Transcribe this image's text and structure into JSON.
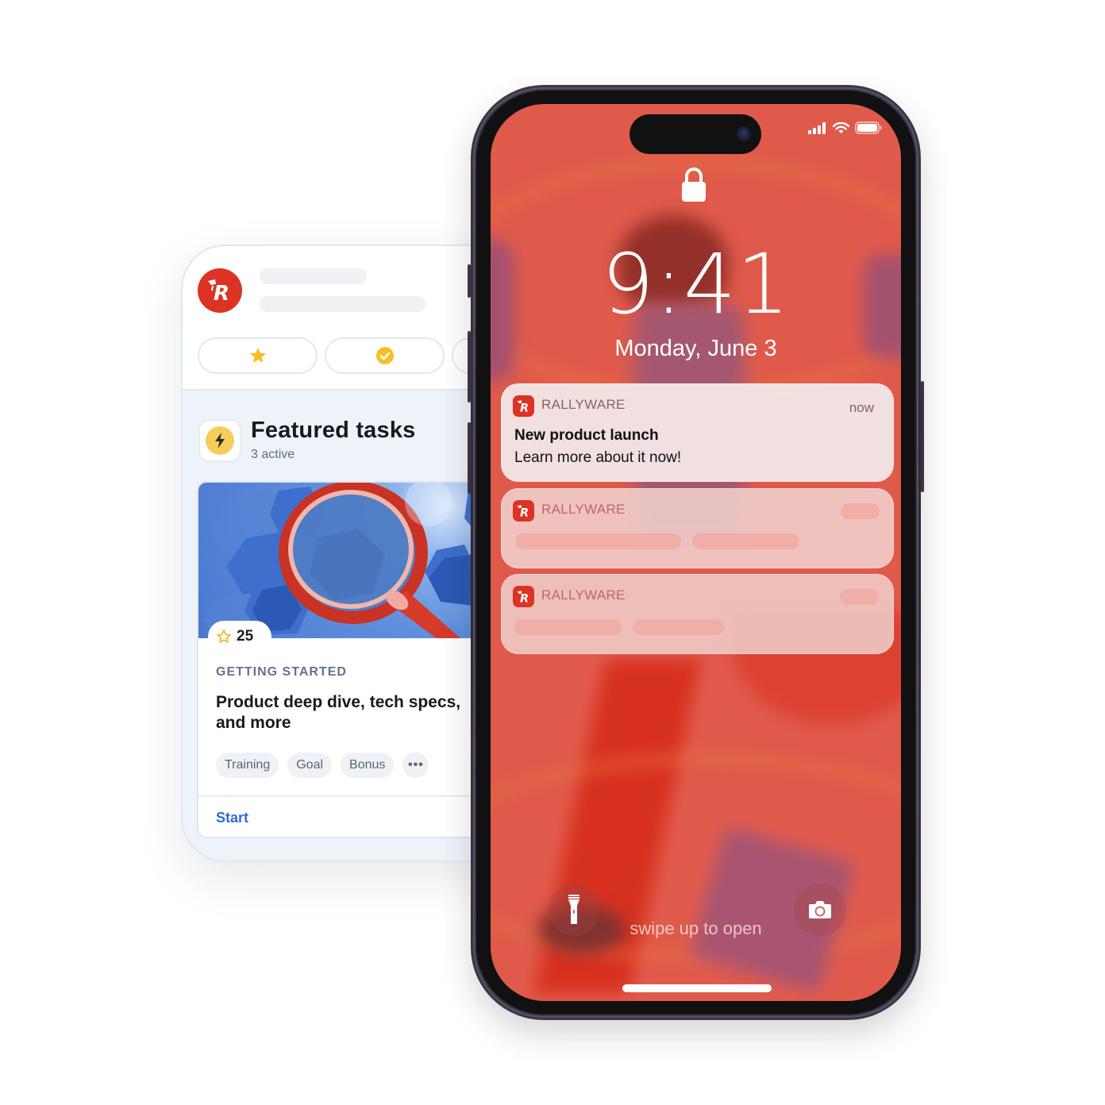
{
  "app": {
    "brand_icon": "rallyware-logo-icon",
    "header_buttons": [
      {
        "icon": "star-icon",
        "color": "#f5bf26"
      },
      {
        "icon": "check-circle-icon",
        "color": "#f5bf26"
      },
      {
        "icon": "",
        "color": ""
      }
    ],
    "section": {
      "icon": "lightning-icon",
      "title": "Featured tasks",
      "subtitle": "3 active"
    },
    "task": {
      "image": "magnifying-glass-illustration",
      "points": "25",
      "category": "GETTING STARTED",
      "title": "Product deep dive, tech specs, and more",
      "tags": [
        "Training",
        "Goal",
        "Bonus"
      ],
      "more_label": "•••",
      "action_label": "Start"
    },
    "colors": {
      "brand": "#dc3324",
      "link": "#2f6ad6",
      "accent_yellow": "#f6cd5a"
    }
  },
  "lockscreen": {
    "status_bar": {
      "signal_icon": "cellular-signal-icon",
      "wifi_icon": "wifi-icon",
      "battery_icon": "battery-icon"
    },
    "lock_icon": "lock-icon",
    "time": "9:41",
    "date": "Monday, June 3",
    "notifications": [
      {
        "app": "RALLYWARE",
        "time": "now",
        "title": "New product launch",
        "body": "Learn more about it now!"
      },
      {
        "app": "RALLYWARE",
        "time": "",
        "title": "",
        "body": ""
      },
      {
        "app": "RALLYWARE",
        "time": "",
        "title": "",
        "body": ""
      }
    ],
    "quick_actions": [
      {
        "icon": "flashlight-icon"
      },
      {
        "icon": "camera-icon"
      }
    ],
    "swipe_hint": "swipe up to open",
    "wallpaper_color": "#e05a4b"
  }
}
